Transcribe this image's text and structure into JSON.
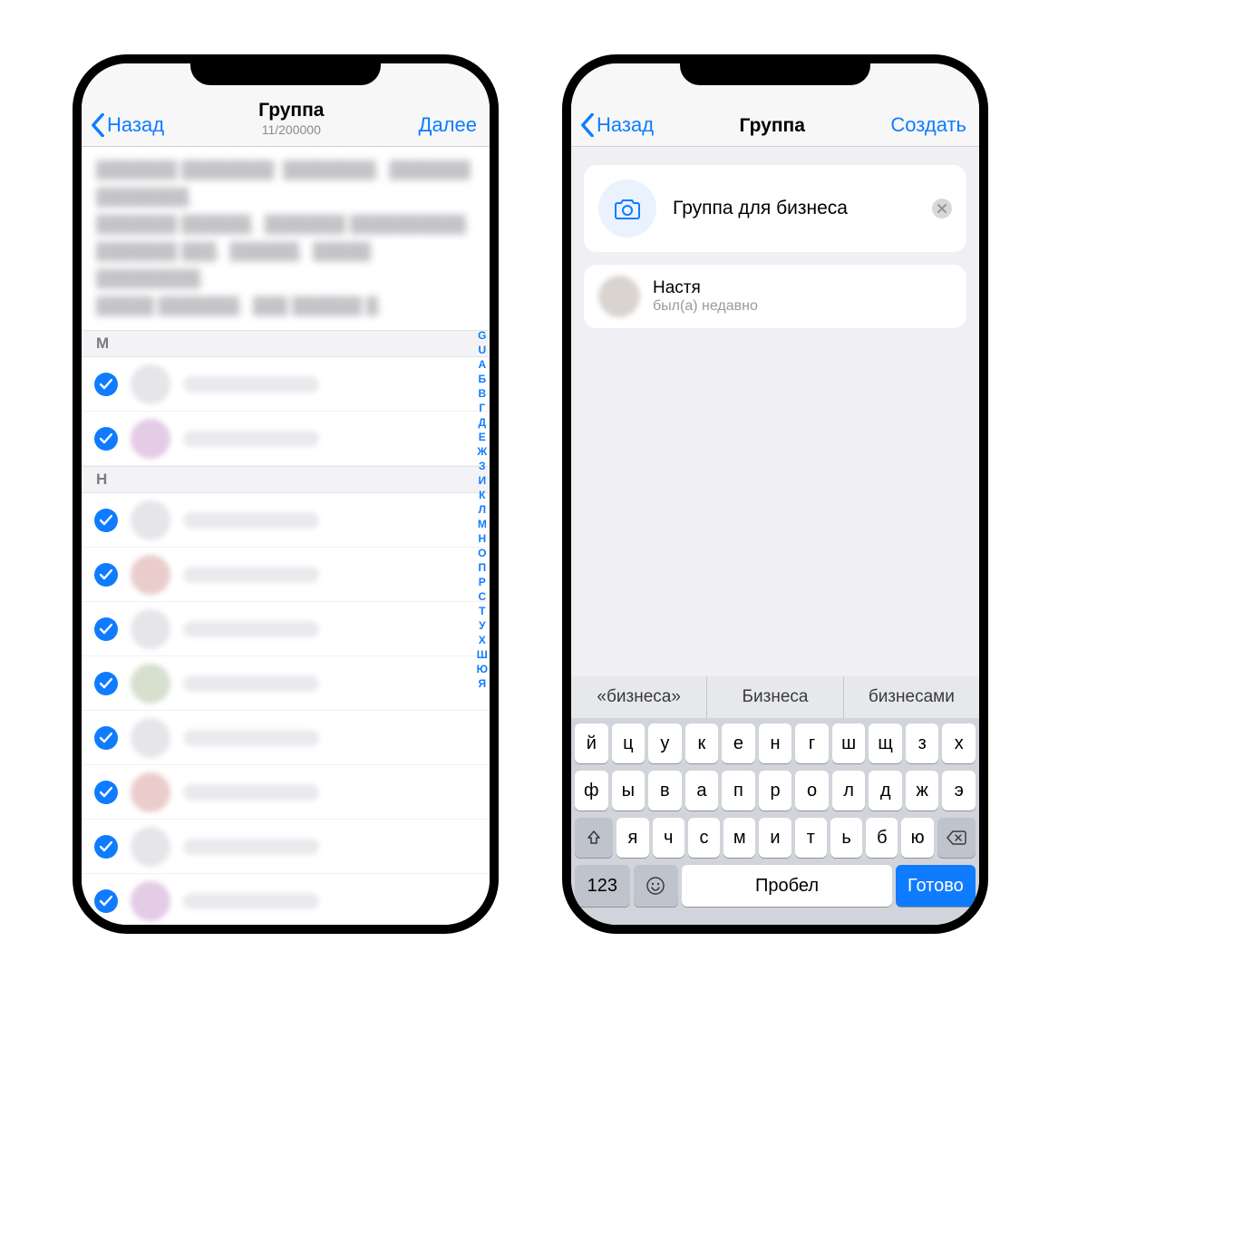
{
  "screen1": {
    "back_label": "Назад",
    "title": "Группа",
    "subtitle": "11/200000",
    "next_label": "Далее",
    "sections": [
      {
        "letter": "М",
        "selected_count": 2
      },
      {
        "letter": "Н",
        "selected_count": 9
      }
    ],
    "index_letters": [
      "G",
      "U",
      "A",
      "Б",
      "В",
      "Г",
      "Д",
      "Е",
      "Ж",
      "З",
      "И",
      "К",
      "Л",
      "М",
      "Н",
      "О",
      "П",
      "Р",
      "С",
      "Т",
      "У",
      "Х",
      "Ш",
      "Ю",
      "Я"
    ]
  },
  "screen2": {
    "back_label": "Назад",
    "title": "Группа",
    "create_label": "Создать",
    "group_name_value": "Группа для бизнеса",
    "member": {
      "name": "Настя",
      "status": "был(а) недавно"
    },
    "suggestions": [
      "«бизнеса»",
      "Бизнеса",
      "бизнесами"
    ],
    "keyboard": {
      "row1": [
        "й",
        "ц",
        "у",
        "к",
        "е",
        "н",
        "г",
        "ш",
        "щ",
        "з",
        "х"
      ],
      "row2": [
        "ф",
        "ы",
        "в",
        "а",
        "п",
        "р",
        "о",
        "л",
        "д",
        "ж",
        "э"
      ],
      "row3": [
        "я",
        "ч",
        "с",
        "м",
        "и",
        "т",
        "ь",
        "б",
        "ю"
      ],
      "mode_key": "123",
      "space_label": "Пробел",
      "done_label": "Готово"
    }
  }
}
